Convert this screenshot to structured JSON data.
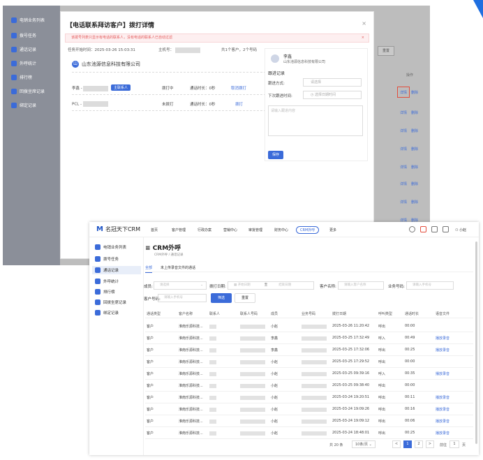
{
  "back": {
    "sidebar": [
      "电销业务列表",
      "拨号任务",
      "通话记录",
      "外呼统计",
      "排行榜",
      "回拨坐席记录",
      "绑定记录"
    ],
    "reset": "重置",
    "op_header": "操作",
    "links": [
      "详情",
      "删除"
    ]
  },
  "modal": {
    "title": "【电话联系拜访客户】拨打详情",
    "close": "×",
    "warning": "该拨号列表只显示有电话的联系人，没有电话的联系人已自动过滤",
    "task_start": "任务开始时间：2025-03-26 15:03:31",
    "host": "主机号：",
    "summary": "共1个客户，2个号码",
    "company": "山东池源信息科技有限公司",
    "company_icon": "山",
    "contacts": [
      {
        "name": "李鑫 -",
        "tag": "主联系人",
        "status": "拨打中",
        "duration": "通话时长：0秒",
        "action": "取消拨打"
      },
      {
        "name": "PCL -",
        "tag": "",
        "status": "未拨打",
        "duration": "通话时长：0秒",
        "action": "拨打"
      }
    ]
  },
  "panel": {
    "name": "李鑫",
    "company": "山东池源信息科技有限公司",
    "section": "跟进记录",
    "method_label": "跟进方式:",
    "method_placeholder": "请选择",
    "next_label": "下次跟进时间:",
    "next_placeholder": "选择日期时间",
    "content_placeholder": "请输入跟进内容",
    "save": "保存"
  },
  "front": {
    "logo": "名冠天下CRM",
    "nav": [
      "首页",
      "客户管理",
      "行政办案",
      "营销中心",
      "审批管理",
      "财务中心",
      "CRM外呼",
      "更多"
    ],
    "user": "小赵",
    "sidebar": [
      "电销业务列表",
      "拨号任务",
      "通话记录",
      "外呼统计",
      "排行榜",
      "回拨坐席记录",
      "绑定记录"
    ],
    "page_title": "CRM外呼",
    "breadcrumb": "CRM外呼 / 通话记录",
    "tabs": [
      "全部",
      "未上传录音文件的通话"
    ],
    "filters": {
      "member_label": "成员:",
      "member_placeholder": "请选择",
      "date_label": "拨打日期:",
      "date_start": "开始日期",
      "date_to": "至",
      "date_end": "结束日期",
      "customer_label": "客户名称:",
      "customer_placeholder": "请输入客户名称",
      "biz_label": "业务号码:",
      "biz_placeholder": "请输入手机号",
      "phone_label": "客户号码:",
      "phone_placeholder": "请输入手机号",
      "search": "筛选",
      "reset": "重置"
    },
    "table_headers": [
      "通话类型",
      "客户名称",
      "联系人",
      "联系人号码",
      "成员",
      "业务号码",
      "拨打日期",
      "呼叫类型",
      "通话时长",
      "语音文件"
    ],
    "rows": [
      {
        "type": "客户",
        "customer": "淮南乐源科技...",
        "member": "小赵",
        "date": "2025-03-26 11:20:42",
        "call": "呼出",
        "dur": "00:00",
        "file": ""
      },
      {
        "type": "客户",
        "customer": "淮南乐源科技...",
        "member": "李鑫",
        "date": "2025-03-25 17:32:49",
        "call": "呼入",
        "dur": "00:49",
        "file": "播放录音"
      },
      {
        "type": "客户",
        "customer": "淮南乐源科技...",
        "member": "李鑫",
        "date": "2025-03-25 17:32:06",
        "call": "呼出",
        "dur": "00:25",
        "file": "播放录音"
      },
      {
        "type": "客户",
        "customer": "淮南乐源科技...",
        "member": "小赵",
        "date": "2025-03-25 17:29:52",
        "call": "呼出",
        "dur": "00:00",
        "file": ""
      },
      {
        "type": "客户",
        "customer": "淮南乐源科技...",
        "member": "小赵",
        "date": "2025-03-25 09:39:16",
        "call": "呼入",
        "dur": "00:35",
        "file": "播放录音"
      },
      {
        "type": "客户",
        "customer": "淮南乐源科技...",
        "member": "小赵",
        "date": "2025-03-25 09:38:40",
        "call": "呼出",
        "dur": "00:00",
        "file": ""
      },
      {
        "type": "客户",
        "customer": "淮南乐源科技...",
        "member": "小赵",
        "date": "2025-03-24 19:20:51",
        "call": "呼出",
        "dur": "00:11",
        "file": "播放录音"
      },
      {
        "type": "客户",
        "customer": "淮南乐源科技...",
        "member": "小赵",
        "date": "2025-03-24 19:09:26",
        "call": "呼出",
        "dur": "00:16",
        "file": "播放录音"
      },
      {
        "type": "客户",
        "customer": "淮南乐源科技...",
        "member": "小赵",
        "date": "2025-03-24 19:09:12",
        "call": "呼出",
        "dur": "00:06",
        "file": "播放录音"
      },
      {
        "type": "客户",
        "customer": "淮南乐源科技...",
        "member": "小赵",
        "date": "2025-03-24 18:48:01",
        "call": "呼出",
        "dur": "00:25",
        "file": "播放录音"
      }
    ],
    "pagination": {
      "total": "共 20 条",
      "size": "10条/页",
      "prev": "<",
      "pages": [
        "1",
        "2"
      ],
      "next": ">",
      "goto": "前往",
      "goto_page": "1",
      "page_unit": "页"
    }
  }
}
